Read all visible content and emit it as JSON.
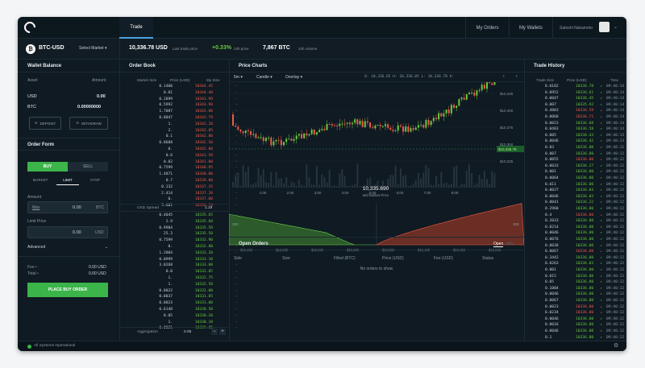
{
  "nav": {
    "trade": "Trade",
    "my_orders": "My Orders",
    "my_wallets": "My Wallets",
    "user": "Satoshi Nakamoto"
  },
  "market": {
    "pair": "BTC-USD",
    "select": "Select Market",
    "last_price": "10,336.78 USD",
    "last_label": "Last trade price",
    "change": "+0.33%",
    "change_label": "24h price",
    "volume": "7,867 BTC",
    "volume_label": "24h volume"
  },
  "wallet": {
    "title": "Wallet Balance",
    "col_asset": "Asset",
    "col_amount": "Amount",
    "rows": [
      {
        "asset": "USD",
        "amount": "0.00"
      },
      {
        "asset": "BTC",
        "amount": "0.00000000"
      }
    ],
    "deposit": "DEPOSIT",
    "withdraw": "WITHDRAW"
  },
  "order_form": {
    "title": "Order Form",
    "buy": "BUY",
    "sell": "SELL",
    "types": [
      "MARKET",
      "LIMIT",
      "STOP"
    ],
    "amount_label": "Amount",
    "amount_ph": "Max",
    "amount_val": "0.00",
    "amount_unit": "BTC",
    "limit_label": "Limit Price",
    "limit_val": "0.00",
    "limit_unit": "USD",
    "advanced": "Advanced",
    "fee_label": "Fee •",
    "fee_val": "0.00 USD",
    "total_label": "Total •",
    "total_val": "0.00 USD",
    "submit": "PLACE BUY ORDER"
  },
  "order_book": {
    "title": "Order Book",
    "col_market_size": "Market Size",
    "col_price": "Price (USD)",
    "col_my_size": "My Size",
    "spread_label": "USD Spread",
    "spread_val": "1.19",
    "agg_label": "Aggregation",
    "agg_val": "0.05",
    "minus": "−",
    "plus": "+",
    "asks": [
      [
        "0.1400",
        "10344.45"
      ],
      [
        "0.01",
        "10344.40"
      ],
      [
        "0.2899",
        "10343.99"
      ],
      [
        "0.5992",
        "10343.90"
      ],
      [
        "1.7087",
        "10343.80"
      ],
      [
        "0.0047",
        "10343.79"
      ],
      [
        "1.",
        "10343.20"
      ],
      [
        "2.",
        "10342.85"
      ],
      [
        "0.1",
        "10342.80"
      ],
      [
        "0.0688",
        "10342.50"
      ],
      [
        "0.",
        "10342.00"
      ],
      [
        "0.6",
        "10341.50"
      ],
      [
        "0.02",
        "10341.00"
      ],
      [
        "0.7599",
        "10340.95"
      ],
      [
        "1.4871",
        "10340.00"
      ],
      [
        "0.7",
        "10339.00"
      ],
      [
        "0.132",
        "10337.35"
      ],
      [
        "2.414",
        "10337.20"
      ],
      [
        "0.",
        "10337.00"
      ],
      [
        "5.601",
        "10336.78"
      ]
    ],
    "bids": [
      [
        "0.4045",
        "10335.65"
      ],
      [
        "2.9",
        "10335.60"
      ],
      [
        "0.9984",
        "10335.59"
      ],
      [
        "25.3",
        "10335.50"
      ],
      [
        "0.7599",
        "10332.90"
      ],
      [
        "0.",
        "10332.80"
      ],
      [
        "1.2804",
        "10333.20"
      ],
      [
        "0.0999",
        "10333.10"
      ],
      [
        "3.0268",
        "10333.00"
      ],
      [
        "0.0",
        "10332.85"
      ],
      [
        "1.",
        "10332.75"
      ],
      [
        "1.",
        "10332.50"
      ],
      [
        "0.0022",
        "10332.00"
      ],
      [
        "0.0037",
        "10331.85"
      ],
      [
        "0.0023",
        "10331.00"
      ],
      [
        "0.6148",
        "10330.50"
      ],
      [
        "0.05",
        "10330.20"
      ],
      [
        "1.",
        "10330.10"
      ],
      [
        "0.0021",
        "10329.05"
      ]
    ]
  },
  "price_chart": {
    "title": "Price Charts",
    "interval": "5m",
    "chart_type": "Candle",
    "overlay": "Overlay",
    "ohlc": "O: 10,336.65  H: 10,336.05  L: 10,336.78  V:",
    "y_ticks": [
      "$10,425",
      "$10,400",
      "$10,375",
      "$10,350",
      "$10,325"
    ],
    "current_tag": "$10,336.78",
    "x_ticks": [
      "1:00",
      "2:00",
      "3:00",
      "4:00",
      "5:00",
      "6:00",
      "7:00",
      "8:00"
    ],
    "mid_price": "10,335.690",
    "mid_label": "Mid Market Price",
    "depth_x": [
      "$10,150",
      "$10,200",
      "$10,250",
      "$10,300",
      "$10,350",
      "$10,400",
      "$10,450",
      "$10,500"
    ],
    "depth_left": "300",
    "depth_right": "300"
  },
  "open_orders": {
    "title": "Open Orders",
    "tab_open": "Open",
    "tab_fills": "Fills",
    "cols": [
      "Side",
      "Size",
      "Filled (BTC)",
      "Price (USD)",
      "Fee (USD)",
      "Status"
    ],
    "empty": "No orders to show"
  },
  "trade_history": {
    "title": "Trade History",
    "col_size": "Trade Size",
    "col_price": "Price (USD)",
    "col_time": "Time",
    "rows": [
      [
        "0.0102",
        "10336.78",
        "g",
        "09:40:14"
      ],
      [
        "0.0952",
        "10336.61",
        "g",
        "09:40:14"
      ],
      [
        "0.0047",
        "10336.45",
        "g",
        "09:40:14"
      ],
      [
        "0.007",
        "10335.92",
        "g",
        "09:40:14"
      ],
      [
        "0.4803",
        "10336.59",
        "r",
        "09:40:14"
      ],
      [
        "0.0068",
        "10336.71",
        "r",
        "09:40:14"
      ],
      [
        "0.0023",
        "10336.60",
        "g",
        "09:40:14"
      ],
      [
        "0.0483",
        "10336.58",
        "g",
        "09:40:14"
      ],
      [
        "0.005",
        "10336.43",
        "g",
        "09:40:13"
      ],
      [
        "0.0046",
        "10336.42",
        "g",
        "09:40:13"
      ],
      [
        "0.03",
        "10336.00",
        "g",
        "09:40:12"
      ],
      [
        "0.007",
        "10336.00",
        "g",
        "09:40:12"
      ],
      [
        "0.0055",
        "10336.00",
        "r",
        "09:40:12"
      ],
      [
        "0.0033",
        "10336.27",
        "g",
        "09:40:12"
      ],
      [
        "0.001",
        "10336.00",
        "g",
        "09:40:12"
      ],
      [
        "0.0064",
        "10336.00",
        "g",
        "09:40:12"
      ],
      [
        "0.011",
        "10336.00",
        "g",
        "09:40:12"
      ],
      [
        "0.0027",
        "10336.03",
        "g",
        "09:40:12"
      ],
      [
        "0.0046",
        "10336.03",
        "g",
        "09:40:12"
      ],
      [
        "0.0041",
        "10336.22",
        "g",
        "09:40:12"
      ],
      [
        "0.2968",
        "10336.00",
        "g",
        "09:40:12"
      ],
      [
        "0.4",
        "10336.00",
        "r",
        "09:40:12"
      ],
      [
        "0.2033",
        "10336.00",
        "g",
        "09:40:12"
      ],
      [
        "0.0214",
        "10336.00",
        "g",
        "09:40:12"
      ],
      [
        "0.0046",
        "10336.00",
        "g",
        "09:40:12"
      ],
      [
        "0.0076",
        "10336.00",
        "g",
        "09:40:12"
      ],
      [
        "0.0038",
        "10336.00",
        "g",
        "09:40:12"
      ],
      [
        "0.0067",
        "10336.00",
        "r",
        "09:40:12"
      ],
      [
        "0.3442",
        "10336.00",
        "g",
        "09:40:12"
      ],
      [
        "0.0263",
        "10336.03",
        "g",
        "09:40:12"
      ],
      [
        "0.001",
        "10336.00",
        "g",
        "09:40:12"
      ],
      [
        "0.015",
        "10336.00",
        "g",
        "09:40:12"
      ],
      [
        "0.05",
        "10336.00",
        "g",
        "09:40:12"
      ],
      [
        "0.1004",
        "10336.00",
        "g",
        "09:40:12"
      ],
      [
        "0.0046",
        "10336.00",
        "g",
        "09:40:12"
      ],
      [
        "0.0067",
        "10336.00",
        "g",
        "09:40:12"
      ],
      [
        "0.0023",
        "10336.00",
        "r",
        "09:40:12"
      ],
      [
        "0.0234",
        "10336.00",
        "r",
        "09:40:12"
      ],
      [
        "0.0046",
        "10336.00",
        "g",
        "09:40:12"
      ],
      [
        "0.0016",
        "10336.00",
        "g",
        "09:40:12"
      ],
      [
        "0.0046",
        "10336.00",
        "g",
        "09:40:12"
      ],
      [
        "0.1",
        "10336.00",
        "g",
        "09:40:12"
      ]
    ]
  },
  "status": {
    "text": "All Systems Operational"
  },
  "colors": {
    "buy": "#69c93f",
    "sell": "#ef5a4a",
    "accent": "#4aa3df",
    "bg": "#0f1a22"
  }
}
